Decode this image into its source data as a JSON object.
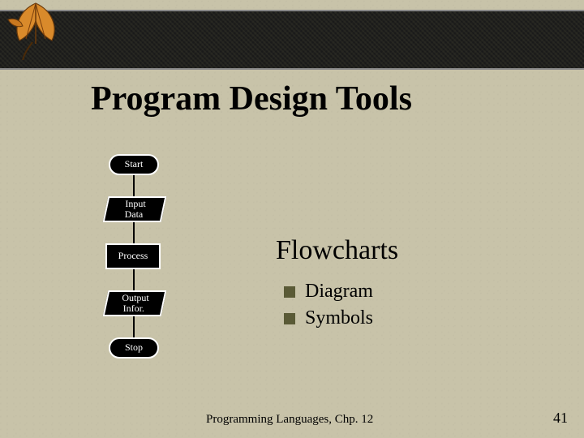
{
  "title": "Program Design Tools",
  "flowchart_nodes": {
    "start": "Start",
    "input_l1": "Input",
    "input_l2": "Data",
    "process": "Process",
    "output_l1": "Output",
    "output_l2": "Infor.",
    "stop": "Stop"
  },
  "subtitle": "Flowcharts",
  "bullets": {
    "b1": "Diagram",
    "b2": "Symbols"
  },
  "footer": "Programming Languages, Chp. 12",
  "page_number": "41"
}
